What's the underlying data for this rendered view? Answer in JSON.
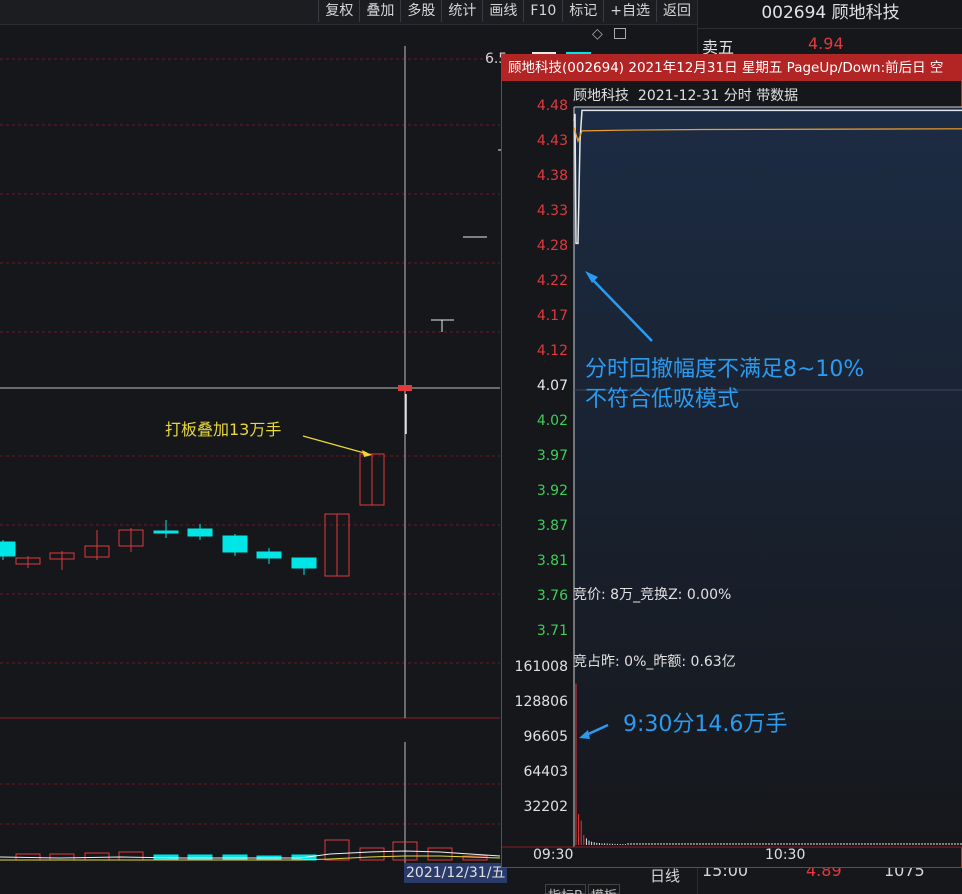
{
  "toolbar": {
    "items": [
      "复权",
      "叠加",
      "多股",
      "统计",
      "画线",
      "F10",
      "标记",
      "+自选",
      "返回"
    ]
  },
  "quote_panel": {
    "title": "002694 顾地科技",
    "sell5_label": "卖五",
    "sell5_price": "4.94",
    "bottom_time": "15:00",
    "bottom_price": "4.89",
    "bottom_volume": "1075"
  },
  "kline": {
    "partial_top_label": "6.5",
    "annotation": "打板叠加13万手",
    "date_tag": "2021/12/31/五",
    "period_label": "日线",
    "bottom_tabs": [
      "指标B",
      "模板"
    ],
    "colors": {
      "up": "#e0393e",
      "down": "#00e5e5",
      "annotation": "#e8d83a"
    }
  },
  "popup": {
    "title": "顾地科技(002694) 2021年12月31日 星期五 PageUp/Down:前后日 空",
    "subtitle_name": "顾地科技",
    "subtitle_date": "2021-12-31",
    "subtitle_mode": "分时",
    "subtitle_extra": "带数据",
    "price_ticks": [
      "4.48",
      "4.43",
      "4.38",
      "4.33",
      "4.28",
      "4.22",
      "4.17",
      "4.12",
      "4.07",
      "4.02",
      "3.97",
      "3.92",
      "3.87",
      "3.81",
      "3.76",
      "3.71"
    ],
    "volume_ticks": [
      "161008",
      "128806",
      "96605",
      "64403",
      "32202"
    ],
    "auction_info_1": "竞价: 8万_竞换Z: 0.00%",
    "auction_info_2": "竞占昨: 0%_昨额: 0.63亿",
    "time_start": "09:30",
    "time_mid": "10:30",
    "annotation_1_line1": "分时回撤幅度不满足8~10%",
    "annotation_1_line2": "不符合低吸模式",
    "annotation_2": "9:30分14.6万手",
    "colors": {
      "up": "#e0393e",
      "down": "#3ccf5a",
      "neutral": "#e8e8e8",
      "price_line": "#f0a030",
      "annotation": "#2a9bf0"
    }
  }
}
